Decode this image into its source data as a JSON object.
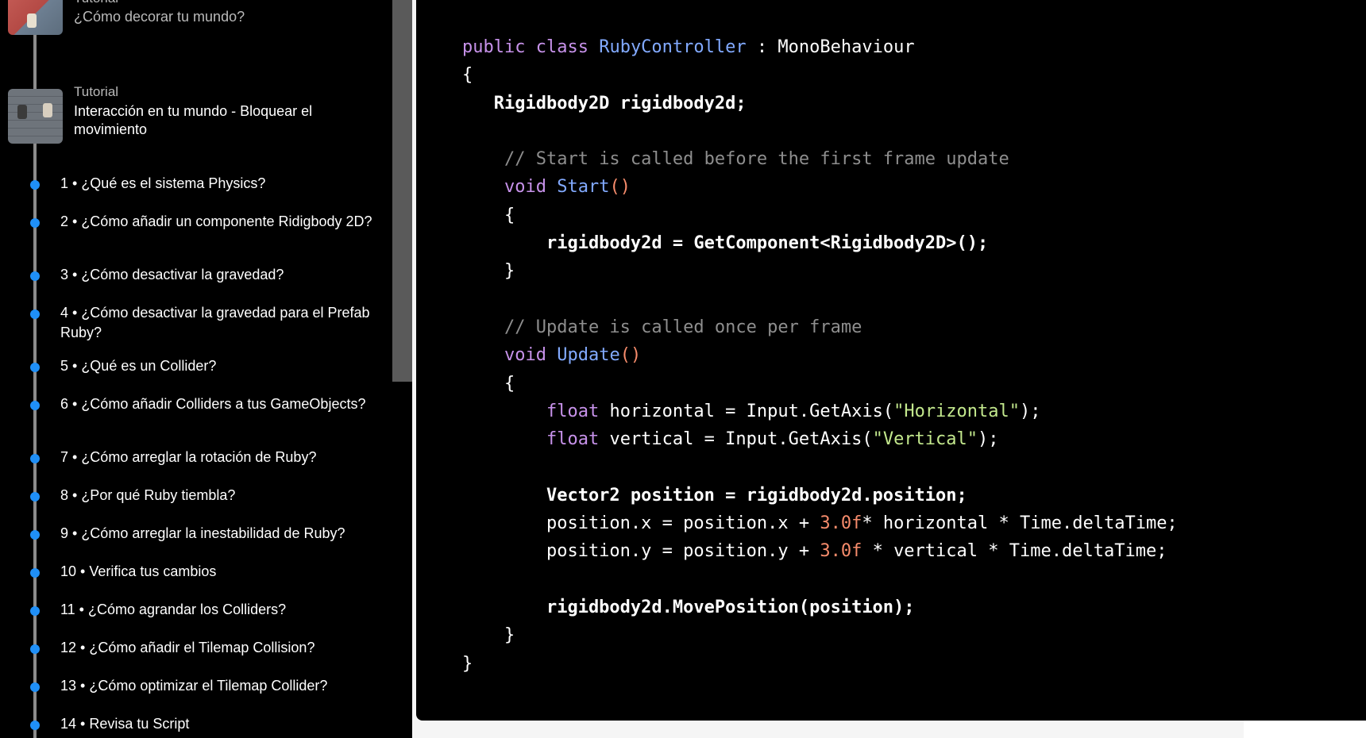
{
  "sidebar": {
    "tutorials": [
      {
        "label": "Tutorial",
        "title": "¿Cómo decorar tu mundo?"
      },
      {
        "label": "Tutorial",
        "title": "Interacción en tu mundo - Bloquear el movimiento"
      }
    ],
    "steps": [
      "1 • ¿Qué es el sistema Physics?",
      "2 • ¿Cómo añadir un componente Ridigbody 2D?",
      "3 • ¿Cómo desactivar la gravedad?",
      "4 • ¿Cómo desactivar la gravedad para el Prefab Ruby?",
      "5 • ¿Qué es un Collider?",
      "6 • ¿Cómo añadir Colliders a tus GameObjects?",
      "7 • ¿Cómo arreglar la rotación de Ruby?",
      "8 • ¿Por qué Ruby tiembla?",
      "9 • ¿Cómo arreglar la inestabilidad de Ruby?",
      "10 • Verifica tus cambios",
      "11 • ¿Cómo agrandar los Colliders?",
      "12 • ¿Cómo añadir el Tilemap Collision?",
      "13 • ¿Cómo optimizar el Tilemap Collider?",
      "14 • Revisa tu Script"
    ],
    "accent_color": "#1f8ff7"
  },
  "code": {
    "language": "csharp",
    "lines": [
      "public class RubyController : MonoBehaviour",
      "{",
      "   Rigidbody2D rigidbody2d;",
      "",
      "    // Start is called before the first frame update",
      "    void Start()",
      "    {",
      "        rigidbody2d = GetComponent<Rigidbody2D>();",
      "    }",
      "",
      "    // Update is called once per frame",
      "    void Update()",
      "    {",
      "        float horizontal = Input.GetAxis(\"Horizontal\");",
      "        float vertical = Input.GetAxis(\"Vertical\");",
      "",
      "        Vector2 position = rigidbody2d.position;",
      "        position.x = position.x + 3.0f* horizontal * Time.deltaTime;",
      "        position.y = position.y + 3.0f * vertical * Time.deltaTime;",
      "",
      "        rigidbody2d.MovePosition(position);",
      "    }",
      "}"
    ]
  }
}
